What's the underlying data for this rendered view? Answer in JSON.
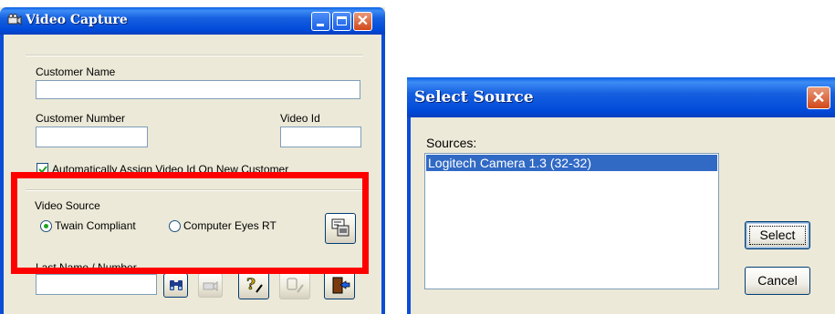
{
  "video_capture": {
    "title": "Video Capture",
    "customer_name_label": "Customer Name",
    "customer_name_value": "",
    "customer_number_label": "Customer Number",
    "customer_number_value": "",
    "video_id_label": "Video Id",
    "video_id_value": "",
    "auto_assign_label": "Automatically Assign Video Id On New Customer",
    "auto_assign_checked": true,
    "video_source_label": "Video Source",
    "radio_twain_label": "Twain Compliant",
    "radio_computer_eyes_label": "Computer Eyes RT",
    "selected_source": "Twain Compliant",
    "last_name_label": "Last Name / Number",
    "last_name_value": ""
  },
  "select_source": {
    "title": "Select Source",
    "sources_label": "Sources:",
    "sources": [
      "Logitech Camera 1.3 (32-32)"
    ],
    "selected_index": 0,
    "select_button": "Select",
    "cancel_button": "Cancel"
  },
  "colors": {
    "titlebar_blue": "#0a5ee3",
    "dialog_face": "#ece9d8",
    "highlight_red": "#ff0000",
    "selection_blue": "#316ac5"
  }
}
